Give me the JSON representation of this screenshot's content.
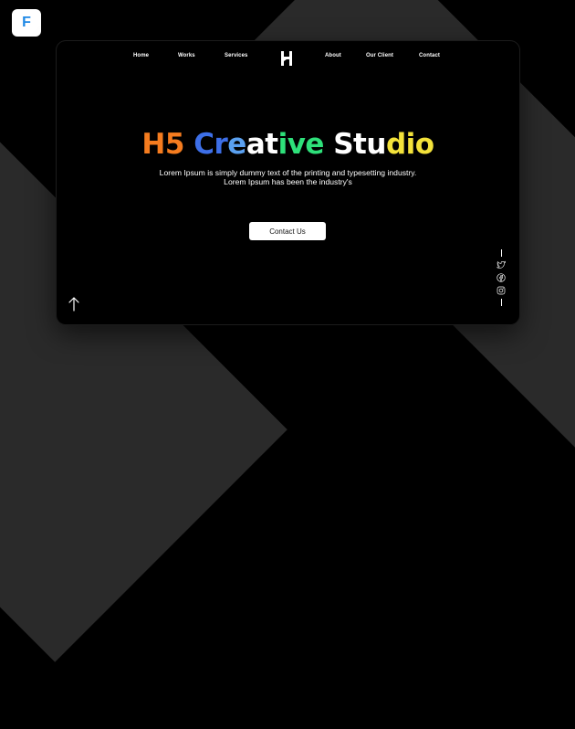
{
  "app_badge": {
    "letter": "F",
    "color": "#1e88e5"
  },
  "nav": {
    "items": [
      {
        "label": "Home"
      },
      {
        "label": "Works"
      },
      {
        "label": "Services"
      },
      {
        "label": "About"
      },
      {
        "label": "Our Client"
      },
      {
        "label": "Contact"
      }
    ],
    "logo_icon": "h-monogram-logo"
  },
  "hero": {
    "title_parts": [
      {
        "text": "H5 ",
        "color": "#f57c1f"
      },
      {
        "text": "Cr",
        "color": "#3d6fe8"
      },
      {
        "text": "e",
        "color": "#5aa0f0"
      },
      {
        "text": "at",
        "color": "#ffffff"
      },
      {
        "text": "ive ",
        "color": "#2ee07a"
      },
      {
        "text": "Stu",
        "color": "#ffffff"
      },
      {
        "text": "dio",
        "color": "#f3e23a"
      }
    ],
    "subtitle_line1": "Lorem Ipsum is simply dummy text of the printing and typesetting industry.",
    "subtitle_line2": "Lorem Ipsum has been the industry's",
    "cta_label": "Contact Us"
  },
  "social_icons": [
    "twitter-icon",
    "facebook-icon",
    "instagram-icon"
  ],
  "back_to_top_icon": "arrow-up-icon",
  "colors": {
    "page_bg": "#000000",
    "stripe": "#2a2a2a",
    "card_bg": "#000000",
    "text": "#ffffff"
  }
}
